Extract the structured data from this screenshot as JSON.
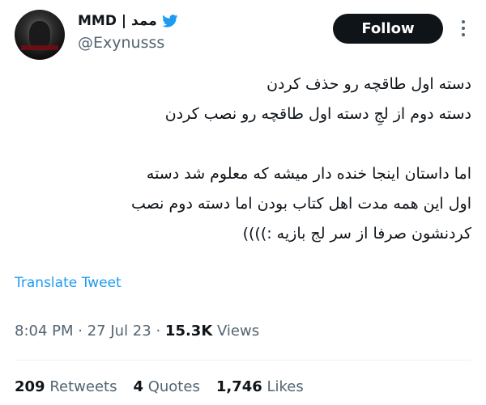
{
  "author": {
    "display_name": "MMD | ممد",
    "handle": "@Exynusss"
  },
  "follow_label": "Follow",
  "tweet": {
    "lines": [
      "دسته اول طاقچه رو حذف کردن",
      "دسته دوم از لجِ دسته اول طاقچه رو نصب کردن",
      "",
      "اما داستان اینجا خنده دار میشه که معلوم شد دسته",
      "اول این همه مدت اهل کتاب بودن اما دسته دوم نصب",
      "کردنشون صرفا از سر لج بازیه :))))"
    ]
  },
  "translate_label": "Translate Tweet",
  "meta": {
    "time": "8:04 PM",
    "date": "27 Jul 23",
    "views_count": "15.3K",
    "views_label": "Views",
    "separator": "·"
  },
  "stats": {
    "retweets_count": "209",
    "retweets_label": "Retweets",
    "quotes_count": "4",
    "quotes_label": "Quotes",
    "likes_count": "1,746",
    "likes_label": "Likes"
  },
  "colors": {
    "text": "#0f1419",
    "secondary": "#536471",
    "link": "#1d9bf0",
    "twitter_blue": "#1d9bf0",
    "button_bg": "#0f1419"
  },
  "icons": {
    "platform": "twitter-bird-icon",
    "more": "more-options-icon"
  }
}
